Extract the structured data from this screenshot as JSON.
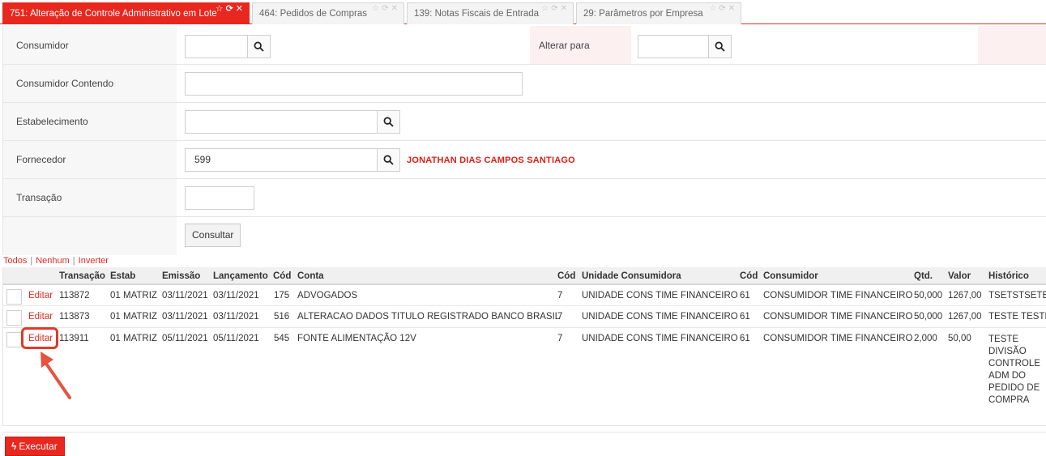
{
  "tabs": [
    {
      "label": "751: Alteração de Controle Administrativo em Lote",
      "active": true
    },
    {
      "label": "464: Pedidos de Compras",
      "active": false
    },
    {
      "label": "139: Notas Fiscais de Entrada",
      "active": false
    },
    {
      "label": "29: Parâmetros por Empresa",
      "active": false
    }
  ],
  "tab_icons": {
    "star": "☆",
    "refresh": "⟳",
    "close": "✕"
  },
  "form": {
    "consumidor_label": "Consumidor",
    "consumidor_value": "",
    "alterar_para_label": "Alterar para",
    "alterar_para_value": "",
    "consumidor_contendo_label": "Consumidor Contendo",
    "consumidor_contendo_value": "",
    "estabelecimento_label": "Estabelecimento",
    "estabelecimento_value": "",
    "fornecedor_label": "Fornecedor",
    "fornecedor_value": "599",
    "fornecedor_name": "JONATHAN DIAS CAMPOS SANTIAGO",
    "transacao_label": "Transação",
    "transacao_value": "",
    "consultar_label": "Consultar"
  },
  "selection": {
    "todos": "Todos",
    "nenhum": "Nenhum",
    "inverter": "Inverter",
    "sep": "|"
  },
  "grid": {
    "headers": {
      "transacao": "Transação",
      "estab": "Estab",
      "emissao": "Emissão",
      "lancamento": "Lançamento",
      "cod1": "Cód",
      "conta": "Conta",
      "cod2": "Cód",
      "unidade": "Unidade Consumidora",
      "cod3": "Cód",
      "consumidor": "Consumidor",
      "qtd": "Qtd.",
      "valor": "Valor",
      "historico": "Histórico"
    },
    "edit_label": "Editar",
    "rows": [
      {
        "transacao": "113872",
        "estab": "01 MATRIZ",
        "emissao": "03/11/2021",
        "lancamento": "03/11/2021",
        "cod1": "175",
        "conta": "ADVOGADOS",
        "cod2": "7",
        "unidade": "UNIDADE CONS TIME FINANCEIRO",
        "cod3": "61",
        "consumidor": "CONSUMIDOR TIME FINANCEIRO",
        "qtd": "50,000",
        "valor": "1267,00",
        "historico": "TSETSTSETE"
      },
      {
        "transacao": "113873",
        "estab": "01 MATRIZ",
        "emissao": "03/11/2021",
        "lancamento": "03/11/2021",
        "cod1": "516",
        "conta": "ALTERACAO DADOS TITULO REGISTRADO BANCO BRASIL",
        "cod2": "7",
        "unidade": "UNIDADE CONS TIME FINANCEIRO",
        "cod3": "61",
        "consumidor": "CONSUMIDOR TIME FINANCEIRO",
        "qtd": "50,000",
        "valor": "1267,00",
        "historico": "TESTE TESTE"
      },
      {
        "transacao": "113911",
        "estab": "01 MATRIZ",
        "emissao": "05/11/2021",
        "lancamento": "05/11/2021",
        "cod1": "545",
        "conta": "FONTE ALIMENTAÇÃO 12V",
        "cod2": "7",
        "unidade": "UNIDADE CONS TIME FINANCEIRO",
        "cod3": "61",
        "consumidor": "CONSUMIDOR TIME FINANCEIRO",
        "qtd": "2,000",
        "valor": "50,00",
        "historico": "TESTE DIVISÃO CONTROLE ADM DO PEDIDO DE COMPRA"
      }
    ]
  },
  "executar_label": "Executar",
  "colors": {
    "accent": "#e8271f",
    "link": "#e02c24"
  }
}
